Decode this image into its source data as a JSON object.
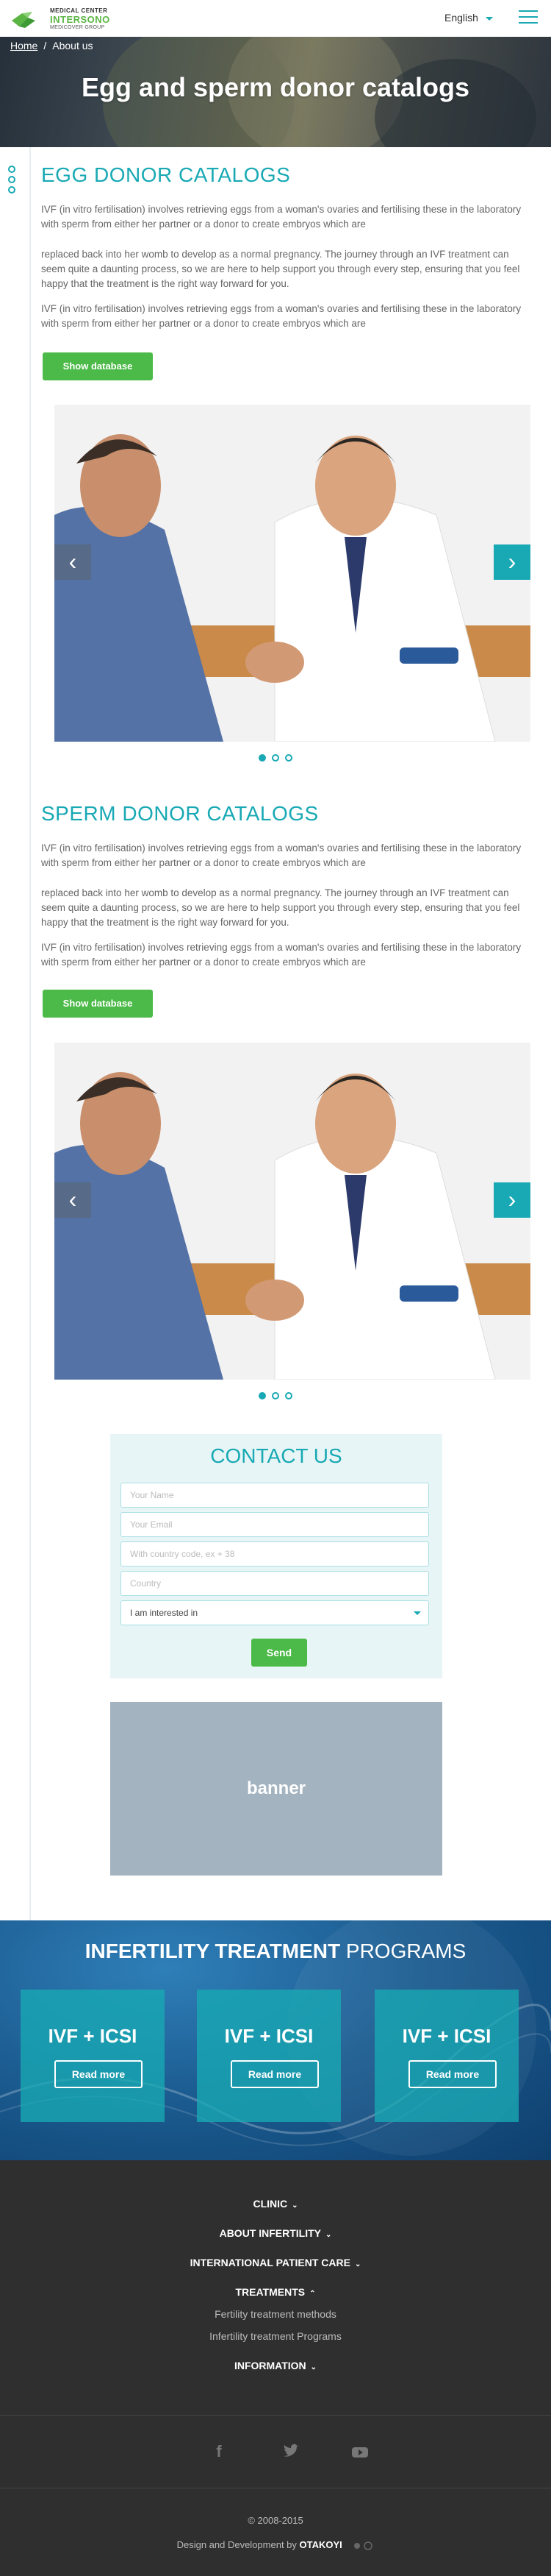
{
  "header": {
    "logo_line1": "MEDICAL CENTER",
    "logo_line2": "INTERSONO",
    "logo_line3": "MEDICOVER GROUP",
    "language": "English"
  },
  "hero": {
    "breadcrumb": [
      "Home",
      "About us"
    ],
    "title": "Egg and sperm donor catalogs"
  },
  "egg": {
    "title": "EGG DONOR CATALOGS",
    "paragraphs": [
      "IVF (in vitro fertilisation) involves retrieving eggs from a woman's ovaries and fertilising these in the laboratory with sperm from either her partner or a donor to create embryos which are",
      "replaced back into her womb to develop as a normal pregnancy. The journey through an IVF treatment can seem quite a daunting process, so we are here to help support you through every step, ensuring that you feel happy that the treatment is the right way forward for you.",
      "IVF (in vitro fertilisation) involves retrieving eggs from a woman's ovaries and fertilising these in the laboratory with sperm from either her partner or a donor to create embryos which are"
    ],
    "button": "Show database"
  },
  "sperm": {
    "title": "SPERM DONOR CATALOGS",
    "paragraphs": [
      "IVF (in vitro fertilisation) involves retrieving eggs from a woman's ovaries and fertilising these in the laboratory with sperm from either her partner or a donor to create embryos which are",
      "replaced back into her womb to develop as a normal pregnancy. The journey through an IVF treatment can seem quite a daunting process, so we are here to help support you through every step, ensuring that you feel happy that the treatment is the right way forward for you.",
      "IVF (in vitro fertilisation) involves retrieving eggs from a woman's ovaries and fertilising these in the laboratory with sperm from either her partner or a donor to create embryos which are"
    ],
    "button": "Show database"
  },
  "contact": {
    "title": "CONTACT US",
    "name_placeholder": "Your Name",
    "email_placeholder": "Your Email",
    "phone_placeholder": "With country code, ex + 38",
    "country_placeholder": "Country",
    "interest_value": "I am interested in",
    "send": "Send"
  },
  "banner": {
    "label": "banner"
  },
  "programs": {
    "title_bold": "INFERTILITY TREATMENT",
    "title_rest": "PROGRAMS",
    "cards": [
      {
        "name": "IVF + ICSI",
        "button": "Read more"
      },
      {
        "name": "IVF + ICSI",
        "button": "Read more"
      },
      {
        "name": "IVF + ICSI",
        "button": "Read more"
      }
    ]
  },
  "footer": {
    "menu": [
      "CLINIC",
      "ABOUT INFERTILITY",
      "INTERNATIONAL PATIENT CARE",
      "TREATMENTS",
      "INFORMATION"
    ],
    "treatments_sub": [
      "Fertility treatment methods",
      "Infertility treatment Programs"
    ],
    "social_icons": [
      "facebook-icon",
      "twitter-icon",
      "youtube-icon"
    ],
    "copyright": "© 2008-2015",
    "credit_prefix": "Design and Development by",
    "credit_name": "OTAKOYI"
  },
  "colors": {
    "accent": "#18a9b4",
    "green": "#4cba48",
    "footer": "#2f2f2f"
  }
}
